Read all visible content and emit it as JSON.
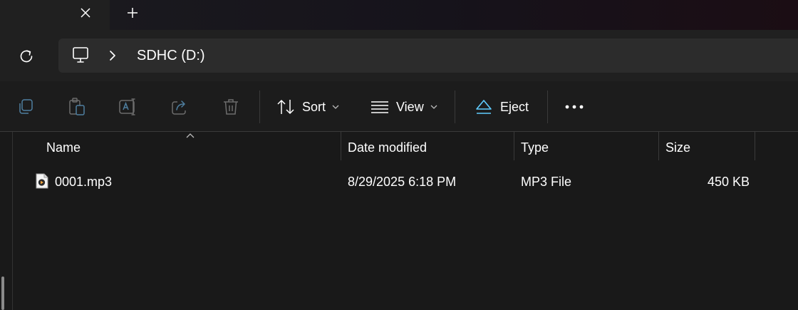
{
  "tabs": {
    "close_icon": "close-icon",
    "new_tab_icon": "plus-icon"
  },
  "address": {
    "refresh_icon": "refresh-icon",
    "location_icon": "this-pc-icon",
    "separator_icon": "chevron-right-icon",
    "breadcrumb": "SDHC (D:)"
  },
  "toolbar": {
    "copy_icon": "copy-icon",
    "paste_icon": "paste-icon",
    "rename_icon": "rename-icon",
    "share_icon": "share-icon",
    "delete_icon": "trash-icon",
    "sort_label": "Sort",
    "view_label": "View",
    "eject_label": "Eject",
    "more_icon": "more-icon"
  },
  "columns": {
    "name": "Name",
    "date_modified": "Date modified",
    "type": "Type",
    "size": "Size",
    "sorted_by": "name"
  },
  "files": [
    {
      "name": "0001.mp3",
      "date_modified": "8/29/2025 6:18 PM",
      "type": "MP3 File",
      "size": "450 KB",
      "icon": "audio-file-icon"
    }
  ],
  "colors": {
    "eject_accent": "#60cdff",
    "background": "#191919",
    "address_bar": "#2c2c2c"
  }
}
